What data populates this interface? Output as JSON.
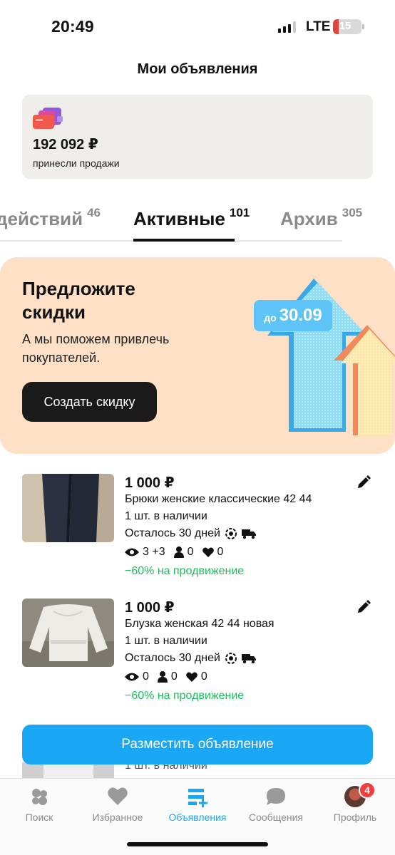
{
  "status": {
    "time": "20:49",
    "network": "LTE",
    "battery": "15"
  },
  "header": {
    "title": "Мои объявления"
  },
  "earnings": {
    "amount": "192 092 ₽",
    "caption": "принесли продажи"
  },
  "tabs": [
    {
      "label": "действий",
      "count": "46",
      "active": false
    },
    {
      "label": "Активные",
      "count": "101",
      "active": true
    },
    {
      "label": "Архив",
      "count": "305",
      "active": false
    }
  ],
  "promo": {
    "title": "Предложите скидки",
    "text": "А мы поможем привлечь покупателей.",
    "button": "Создать скидку",
    "badge_prefix": "до",
    "badge_date": "30.09"
  },
  "listings": [
    {
      "price": "1 000 ₽",
      "title": "Брюки женские классические 42 44",
      "stock": "1 шт. в наличии",
      "days": "Осталось 30 дней",
      "views": "3 +3",
      "contacts": "0",
      "favorites": "0",
      "promotion": "−60% на продвижение"
    },
    {
      "price": "1 000 ₽",
      "title": "Блузка женская 42 44 новая",
      "stock": "1 шт. в наличии",
      "days": "Осталось 30 дней",
      "views": "0",
      "contacts": "0",
      "favorites": "0",
      "promotion": "−60% на продвижение"
    }
  ],
  "third_listing_peek": "1 шт. в наличии",
  "cta": {
    "label": "Разместить объявление"
  },
  "nav": [
    {
      "label": "Поиск",
      "icon": "search-icon"
    },
    {
      "label": "Избранное",
      "icon": "heart-icon"
    },
    {
      "label": "Объявления",
      "icon": "listings-icon",
      "active": true
    },
    {
      "label": "Сообщения",
      "icon": "chat-icon"
    },
    {
      "label": "Профиль",
      "icon": "avatar",
      "badge": "4"
    }
  ],
  "colors": {
    "accent": "#1aa7f5",
    "promo_bg": "#fde0c6",
    "success": "#1cbd5b",
    "badge": "#f03c3c"
  }
}
